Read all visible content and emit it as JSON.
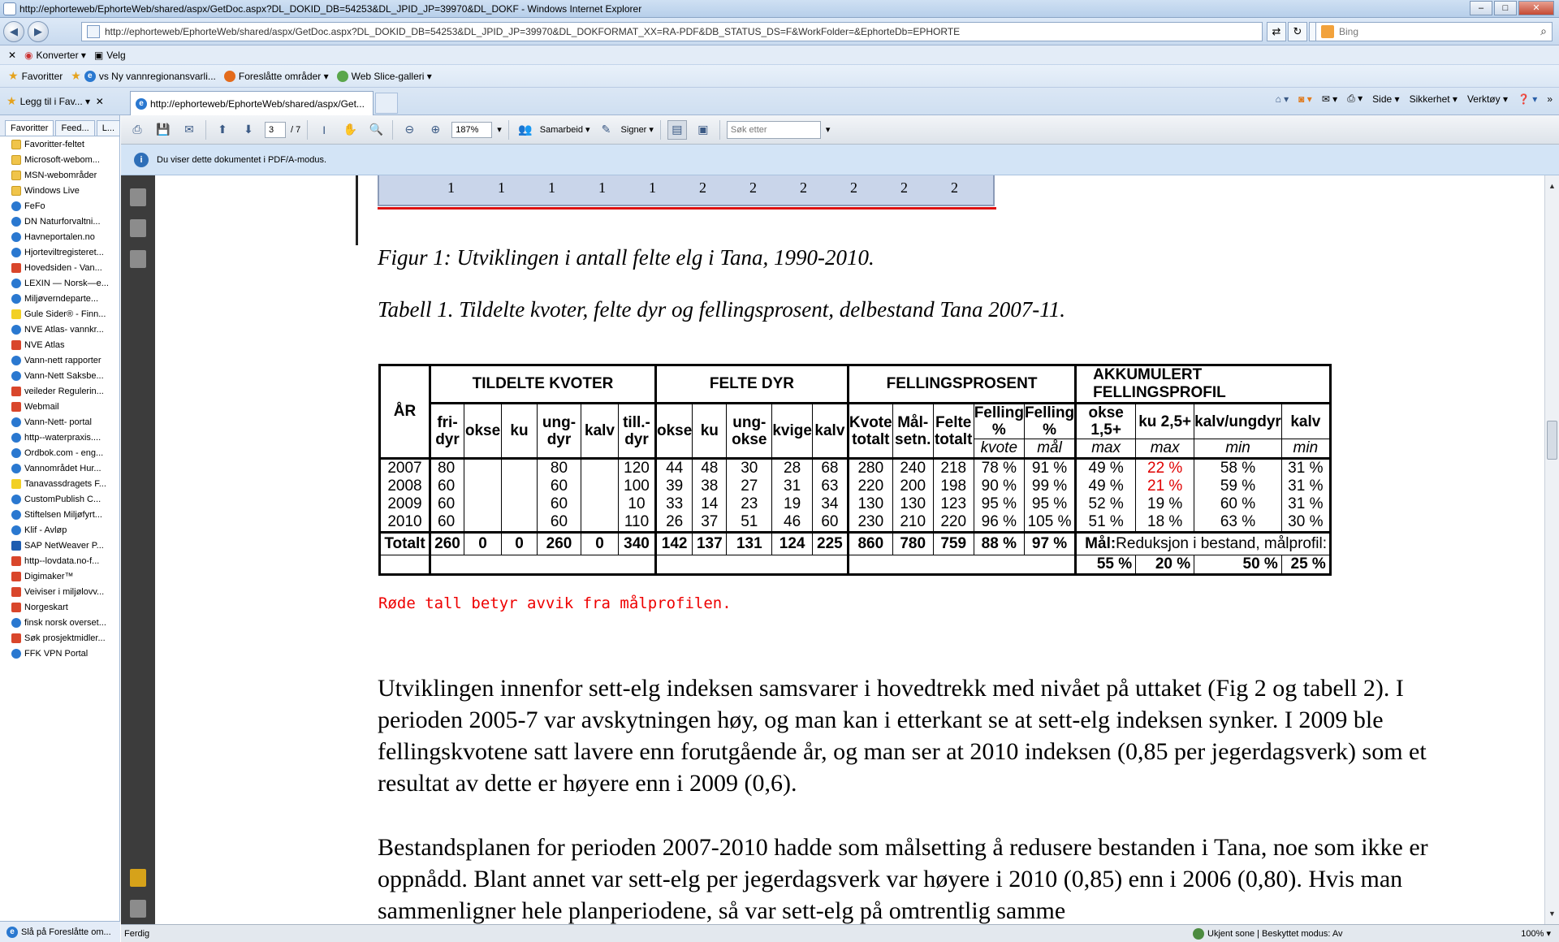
{
  "window": {
    "title": "http://ephorteweb/EphorteWeb/shared/aspx/GetDoc.aspx?DL_DOKID_DB=54253&DL_JPID_JP=39970&DL_DOKF - Windows Internet Explorer",
    "min": "–",
    "max": "□",
    "close": "✕"
  },
  "address": {
    "url": "http://ephorteweb/EphorteWeb/shared/aspx/GetDoc.aspx?DL_DOKID_DB=54253&DL_JPID_JP=39970&DL_DOKFORMAT_XX=RA-PDF&DB_STATUS_DS=F&WorkFolder=&EphorteDb=EPHORTE",
    "search_placeholder": "Bing"
  },
  "command_bar": {
    "konverter": "Konverter",
    "velg": "Velg"
  },
  "favbar": {
    "favoritter": "Favoritter",
    "items": [
      "vs Ny vannregionansvarli...",
      "Foreslåtte områder",
      "Web Slice-galleri"
    ]
  },
  "tabbar": {
    "legg_til": "Legg til i Fav...",
    "tab_title": "http://ephorteweb/EphorteWeb/shared/aspx/Get...",
    "tools": [
      "Side",
      "Sikkerhet",
      "Verktøy"
    ]
  },
  "sidebar": {
    "tabs": [
      "Favoritter",
      "Feed...",
      "L..."
    ],
    "items": [
      {
        "label": "Favoritter-feltet",
        "icon": "folder"
      },
      {
        "label": "Microsoft-webom...",
        "icon": "folder"
      },
      {
        "label": "MSN-webområder",
        "icon": "folder"
      },
      {
        "label": "Windows Live",
        "icon": "folder"
      },
      {
        "label": "FeFo",
        "icon": "ie"
      },
      {
        "label": "DN Naturforvaltni...",
        "icon": "ie"
      },
      {
        "label": "Havneportalen.no",
        "icon": "ie"
      },
      {
        "label": "Hjorteviltregisteret...",
        "icon": "ie"
      },
      {
        "label": "Hovedsiden - Van...",
        "icon": "shield"
      },
      {
        "label": "LEXIN — Norsk—e...",
        "icon": "ie"
      },
      {
        "label": "Miljøverndeparte...",
        "icon": "ie"
      },
      {
        "label": "Gule Sider® - Finn...",
        "icon": "y"
      },
      {
        "label": "NVE Atlas- vannkr...",
        "icon": "ie"
      },
      {
        "label": "NVE Atlas",
        "icon": "shield"
      },
      {
        "label": "Vann-nett rapporter",
        "icon": "ie"
      },
      {
        "label": "Vann-Nett Saksbe...",
        "icon": "ie"
      },
      {
        "label": "veileder Regulerin...",
        "icon": "shield"
      },
      {
        "label": "Webmail",
        "icon": "shield"
      },
      {
        "label": "Vann-Nett- portal",
        "icon": "ie"
      },
      {
        "label": "http--waterpraxis....",
        "icon": "ie"
      },
      {
        "label": "Ordbok.com - eng...",
        "icon": "ie"
      },
      {
        "label": "Vannområdet Hur...",
        "icon": "ie"
      },
      {
        "label": "Tanavassdragets F...",
        "icon": "y"
      },
      {
        "label": "CustomPublish C...",
        "icon": "ie"
      },
      {
        "label": "Stiftelsen Miljøfyrt...",
        "icon": "ie"
      },
      {
        "label": "Klif - Avløp",
        "icon": "ie"
      },
      {
        "label": "SAP NetWeaver P...",
        "icon": "sap"
      },
      {
        "label": "http--lovdata.no-f...",
        "icon": "shield"
      },
      {
        "label": "Digimaker™",
        "icon": "shield"
      },
      {
        "label": "Veiviser i miljølovv...",
        "icon": "shield"
      },
      {
        "label": "Norgeskart",
        "icon": "shield"
      },
      {
        "label": "finsk norsk overset...",
        "icon": "ie"
      },
      {
        "label": "Søk prosjektmidler...",
        "icon": "shield"
      },
      {
        "label": "FFK VPN Portal",
        "icon": "ie"
      }
    ],
    "bottom": "Slå på Foreslåtte om..."
  },
  "pdf_toolbar": {
    "page": "3",
    "of": "/ 7",
    "zoom": "187%",
    "samarbeid": "Samarbeid",
    "signer": "Signer",
    "search_placeholder": "Søk etter"
  },
  "infobar": {
    "text": "Du viser dette dokumentet i PDF/A-modus."
  },
  "doc": {
    "chart_ticks": [
      "1",
      "1",
      "1",
      "1",
      "1",
      "2",
      "2",
      "2",
      "2",
      "2",
      "2"
    ],
    "figure_caption": "Figur 1: Utviklingen i antall felte elg i Tana, 1990-2010.",
    "table_caption": "Tabell 1. Tildelte kvoter, felte dyr og fellingsprosent, delbestand Tana 2007-11.",
    "table": {
      "group_headers": [
        "ÅR",
        "TILDELTE KVOTER",
        "FELTE DYR",
        "FELLINGSPROSENT",
        "AKKUMULERT  FELLINGSPROFIL"
      ],
      "sub_headers": [
        "fri-\ndyr",
        "okse",
        "ku",
        "ung-\ndyr",
        "kalv",
        "till.-\ndyr",
        "okse",
        "ku",
        "ung-\nokse",
        "kvige",
        "kalv",
        "Kvote\ntotalt",
        "Mål-\nsetn.",
        "Felte\ntotalt",
        "Felling %",
        "Felling %",
        "okse 1,5+",
        "ku 2,5+",
        "kalv/ungdyr",
        "kalv"
      ],
      "sub_italics": [
        "kvote",
        "mål",
        "max",
        "max",
        "min",
        "min"
      ],
      "rows": [
        [
          "2007",
          "80",
          "",
          "",
          "80",
          "",
          "120",
          "44",
          "48",
          "30",
          "28",
          "68",
          "280",
          "240",
          "218",
          "78 %",
          "91 %",
          "49 %",
          "22 %",
          "58 %",
          "31 %"
        ],
        [
          "2008",
          "60",
          "",
          "",
          "60",
          "",
          "100",
          "39",
          "38",
          "27",
          "31",
          "63",
          "220",
          "200",
          "198",
          "90 %",
          "99 %",
          "49 %",
          "21 %",
          "59 %",
          "31 %"
        ],
        [
          "2009",
          "60",
          "",
          "",
          "60",
          "",
          "10",
          "33",
          "14",
          "23",
          "19",
          "34",
          "130",
          "130",
          "123",
          "95 %",
          "95 %",
          "52 %",
          "19 %",
          "60 %",
          "31 %"
        ],
        [
          "2010",
          "60",
          "",
          "",
          "60",
          "",
          "110",
          "26",
          "37",
          "51",
          "46",
          "60",
          "230",
          "210",
          "220",
          "96 %",
          "105 %",
          "51 %",
          "18 %",
          "63 %",
          "30 %"
        ]
      ],
      "total_row": [
        "Totalt",
        "260",
        "0",
        "0",
        "260",
        "0",
        "340",
        "142",
        "137",
        "131",
        "124",
        "225",
        "860",
        "780",
        "759",
        "88 %",
        "97 %"
      ],
      "goal_label": "Mål:",
      "goal_text": "Reduksjon i bestand, målprofil:",
      "goal_values": [
        "55 %",
        "20 %",
        "50 %",
        "25 %"
      ],
      "red_color": "#e00000"
    },
    "red_note": "Røde tall betyr avvik fra målprofilen.",
    "para1": "Utviklingen innenfor sett-elg indeksen samsvarer i hovedtrekk med nivået på uttaket (Fig 2 og tabell 2). I perioden 2005-7 var avskytningen høy, og man kan i etterkant se at sett-elg indeksen synker. I 2009 ble fellingskvotene satt lavere enn forutgående år, og man ser at 2010 indeksen (0,85 per jegerdagsverk) som et resultat av dette er høyere enn i 2009 (0,6).",
    "para2": "Bestandsplanen for perioden 2007-2010 hadde som målsetting å redusere bestanden i Tana, noe som ikke er oppnådd. Blant annet var sett-elg per jegerdagsverk var høyere i 2010 (0,85) enn i 2006 (0,80). Hvis man sammenligner hele planperiodene, så var sett-elg på omtrentlig samme"
  },
  "status": {
    "left": "Ferdig",
    "zone": "Ukjent sone | Beskyttet modus: Av",
    "zoom": "100%"
  }
}
